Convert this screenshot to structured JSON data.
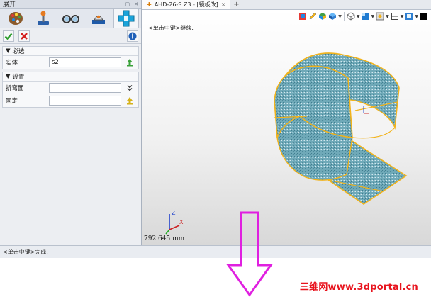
{
  "panel": {
    "title": "展开",
    "tabs": [
      {
        "name": "palette",
        "active": false
      },
      {
        "name": "component",
        "active": false
      },
      {
        "name": "glasses",
        "active": false
      },
      {
        "name": "inspect",
        "active": false
      },
      {
        "name": "sheetmetal",
        "active": true
      }
    ],
    "required_section": {
      "title": "必选",
      "fields": [
        {
          "label": "实体",
          "value": "s2"
        }
      ]
    },
    "settings_section": {
      "title": "设置",
      "fields": [
        {
          "label": "折弯面",
          "value": ""
        },
        {
          "label": "固定",
          "value": ""
        }
      ]
    }
  },
  "document": {
    "tab_title": "AHD-26-S.Z3 - [镜板改]",
    "tab_close": "×",
    "add_tab": "+"
  },
  "viewport": {
    "hint": "<单击中键>继续.",
    "readout": "792.645 mm",
    "axis_labels": {
      "z": "Z",
      "x": "X"
    }
  },
  "status": {
    "text": "<单击中键>完成."
  },
  "watermark": {
    "text": "三维网www.3dportal.cn"
  },
  "colors": {
    "accent_check": "#2e9e2e",
    "accent_cancel": "#d32020",
    "part_fill": "#6fa9b8",
    "part_edge": "#f2b31b",
    "arrow": "#e020e0"
  }
}
